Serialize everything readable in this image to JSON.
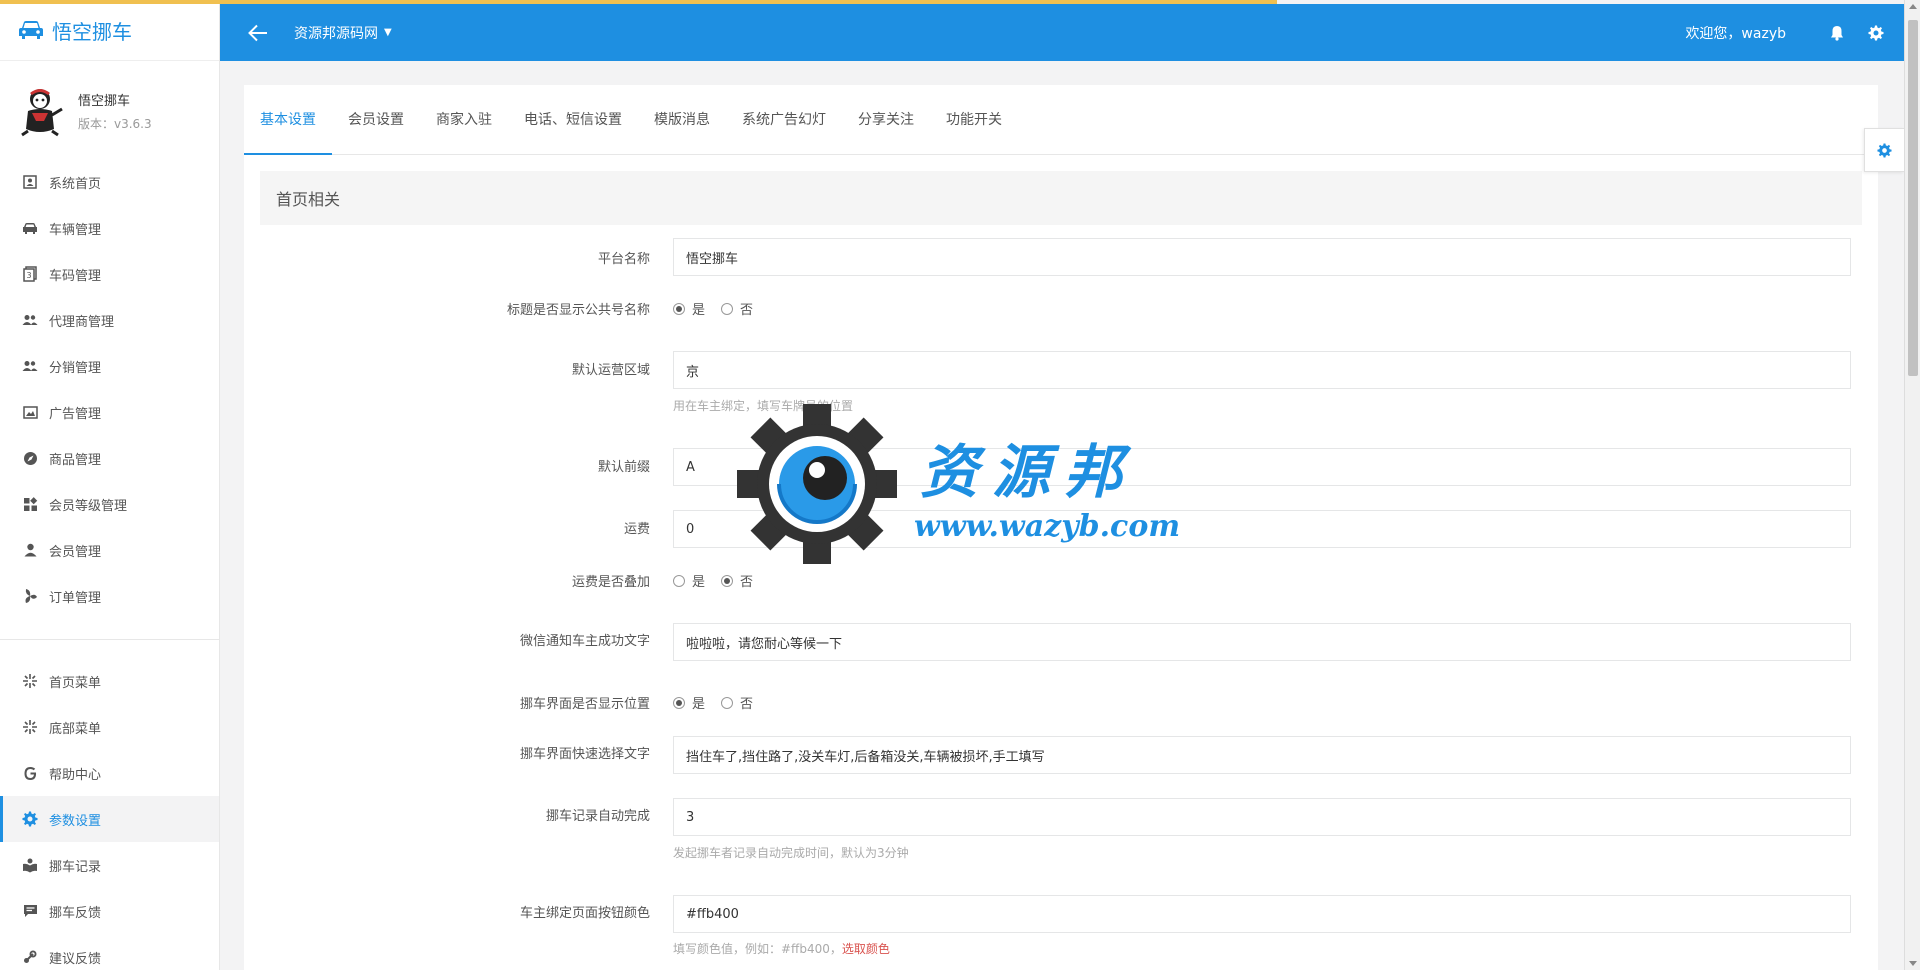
{
  "app": {
    "name": "悟空挪车",
    "profile_name": "悟空挪车",
    "version": "版本：v3.6.3"
  },
  "sidebar": {
    "items": [
      {
        "label": "系统首页",
        "icon": "dashboard-icon"
      },
      {
        "label": "车辆管理",
        "icon": "car-icon"
      },
      {
        "label": "车码管理",
        "icon": "qrcode-icon"
      },
      {
        "label": "代理商管理",
        "icon": "users-icon"
      },
      {
        "label": "分销管理",
        "icon": "users-icon"
      },
      {
        "label": "广告管理",
        "icon": "image-icon"
      },
      {
        "label": "商品管理",
        "icon": "compass-icon"
      },
      {
        "label": "会员等级管理",
        "icon": "grid-icon"
      },
      {
        "label": "会员管理",
        "icon": "user-icon"
      },
      {
        "label": "订单管理",
        "icon": "fan-icon"
      }
    ],
    "items2": [
      {
        "label": "首页菜单",
        "icon": "sparkle-icon"
      },
      {
        "label": "底部菜单",
        "icon": "sparkle-icon"
      },
      {
        "label": "帮助中心",
        "icon": "help-icon"
      },
      {
        "label": "参数设置",
        "icon": "gear-icon",
        "active": true
      },
      {
        "label": "挪车记录",
        "icon": "book-icon"
      },
      {
        "label": "挪车反馈",
        "icon": "chat-icon"
      },
      {
        "label": "建议反馈",
        "icon": "steam-icon"
      }
    ]
  },
  "header": {
    "site_selector": "资源邦源码网",
    "welcome": "欢迎您，wazyb"
  },
  "tabs": [
    "基本设置",
    "会员设置",
    "商家入驻",
    "电话、短信设置",
    "模版消息",
    "系统广告幻灯",
    "分享关注",
    "功能开关"
  ],
  "section": {
    "title": "首页相关"
  },
  "form": {
    "platform_name": {
      "label": "平台名称",
      "value": "悟空挪车"
    },
    "title_show_mp": {
      "label": "标题是否显示公共号名称",
      "yes": "是",
      "no": "否",
      "selected": "yes"
    },
    "default_region": {
      "label": "默认运营区域",
      "value": "京",
      "help": "用在车主绑定，填写车牌号的位置"
    },
    "default_prefix": {
      "label": "默认前缀",
      "value": "A"
    },
    "shipping_fee": {
      "label": "运费",
      "value": "0"
    },
    "fee_stack": {
      "label": "运费是否叠加",
      "yes": "是",
      "no": "否",
      "selected": "no"
    },
    "wx_notify_text": {
      "label": "微信通知车主成功文字",
      "value": "啦啦啦，请您耐心等候一下"
    },
    "show_location": {
      "label": "挪车界面是否显示位置",
      "yes": "是",
      "no": "否",
      "selected": "yes"
    },
    "quick_texts": {
      "label": "挪车界面快速选择文字",
      "value": "挡住车了,挡住路了,没关车灯,后备箱没关,车辆被损坏,手工填写"
    },
    "auto_complete": {
      "label": "挪车记录自动完成",
      "value": "3",
      "help": "发起挪车者记录自动完成时间，默认为3分钟"
    },
    "bind_btn_color": {
      "label": "车主绑定页面按钮颜色",
      "value": "#ffb400",
      "help": "填写颜色值，例如：#ffb400，",
      "help_link": "选取颜色"
    }
  },
  "watermark": {
    "text1": "资源邦",
    "text2": "www.wazyb.com"
  },
  "colors": {
    "primary": "#1e8fe1",
    "loadbar": "#f0c050",
    "link_red": "#d9534f"
  }
}
